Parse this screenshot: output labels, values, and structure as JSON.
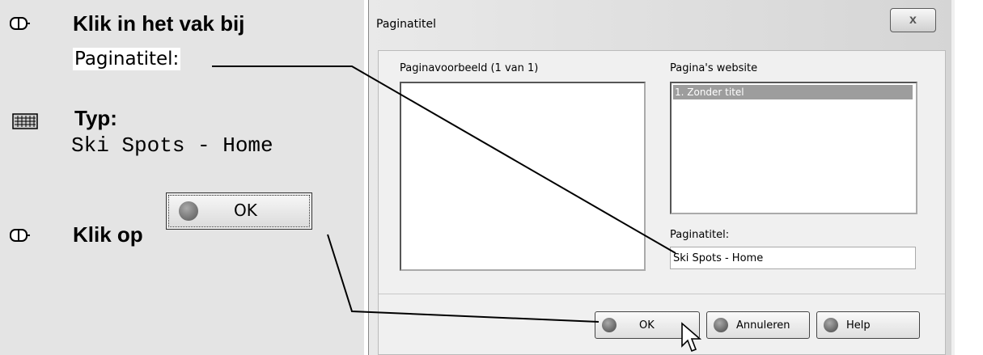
{
  "instructions": {
    "step1_title": "Klik in het vak bij",
    "step1_hint": "Paginatitel:",
    "step2_title": "Typ:",
    "step2_text": "Ski Spots - Home",
    "step3_title": "Klik op",
    "ok_image_label": "OK"
  },
  "dialog": {
    "title": "Paginatitel",
    "close_label": "x",
    "preview_label": "Paginavoorbeeld (1 van 1)",
    "pages_label": "Pagina's website",
    "pages_list": [
      "1. Zonder titel"
    ],
    "page_title_label": "Paginatitel:",
    "page_title_value": "Ski Spots - Home",
    "buttons": {
      "ok": "OK",
      "cancel": "Annuleren",
      "help": "Help"
    }
  },
  "icons": [
    "mouse-icon",
    "keyboard-icon",
    "checkmark-icon",
    "close-icon",
    "cancel-icon",
    "help-icon",
    "cursor-icon"
  ],
  "colors": {
    "panel_bg": "#e4e4e4",
    "list_selection": "#9d9d9d",
    "dialog_bg": "#f0f0f0"
  }
}
